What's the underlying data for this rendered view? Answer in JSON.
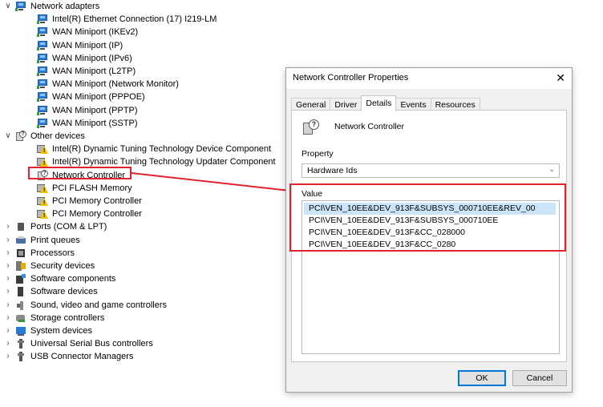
{
  "tree": {
    "items": [
      {
        "label": "Network adapters",
        "icon": "network-adapter-icon",
        "kind": "net",
        "expand": "open"
      },
      {
        "label": "Intel(R) Ethernet Connection (17) I219-LM",
        "icon": "network-adapter-icon",
        "kind": "net"
      },
      {
        "label": "WAN Miniport (IKEv2)",
        "icon": "network-adapter-icon",
        "kind": "net"
      },
      {
        "label": "WAN Miniport (IP)",
        "icon": "network-adapter-icon",
        "kind": "net"
      },
      {
        "label": "WAN Miniport (IPv6)",
        "icon": "network-adapter-icon",
        "kind": "net"
      },
      {
        "label": "WAN Miniport (L2TP)",
        "icon": "network-adapter-icon",
        "kind": "net"
      },
      {
        "label": "WAN Miniport (Network Monitor)",
        "icon": "network-adapter-icon",
        "kind": "net"
      },
      {
        "label": "WAN Miniport (PPPOE)",
        "icon": "network-adapter-icon",
        "kind": "net"
      },
      {
        "label": "WAN Miniport (PPTP)",
        "icon": "network-adapter-icon",
        "kind": "net"
      },
      {
        "label": "WAN Miniport (SSTP)",
        "icon": "network-adapter-icon",
        "kind": "net"
      },
      {
        "label": "Other devices",
        "icon": "unknown-device-icon",
        "kind": "unk",
        "expand": "open"
      },
      {
        "label": "Intel(R) Dynamic Tuning Technology Device Component",
        "icon": "warning-device-icon",
        "kind": "warn"
      },
      {
        "label": "Intel(R) Dynamic Tuning Technology Updater Component",
        "icon": "warning-device-icon",
        "kind": "warn"
      },
      {
        "label": "Network Controller",
        "icon": "unknown-device-icon",
        "kind": "unk"
      },
      {
        "label": "PCI FLASH Memory",
        "icon": "warning-device-icon",
        "kind": "warn"
      },
      {
        "label": "PCI Memory Controller",
        "icon": "warning-device-icon",
        "kind": "warn"
      },
      {
        "label": "PCI Memory Controller",
        "icon": "warning-device-icon",
        "kind": "warn"
      },
      {
        "label": "Ports (COM & LPT)",
        "icon": "port-icon",
        "kind": "port",
        "expand": "closed"
      },
      {
        "label": "Print queues",
        "icon": "printer-icon",
        "kind": "print",
        "expand": "closed"
      },
      {
        "label": "Processors",
        "icon": "processor-icon",
        "kind": "proc",
        "expand": "closed"
      },
      {
        "label": "Security devices",
        "icon": "security-device-icon",
        "kind": "sec",
        "expand": "closed"
      },
      {
        "label": "Software components",
        "icon": "software-component-icon",
        "kind": "comp",
        "expand": "closed"
      },
      {
        "label": "Software devices",
        "icon": "software-device-icon",
        "kind": "sw",
        "expand": "closed"
      },
      {
        "label": "Sound, video and game controllers",
        "icon": "speaker-icon",
        "kind": "snd",
        "expand": "closed"
      },
      {
        "label": "Storage controllers",
        "icon": "storage-controller-icon",
        "kind": "stor",
        "expand": "closed"
      },
      {
        "label": "System devices",
        "icon": "system-device-icon",
        "kind": "sys",
        "expand": "closed"
      },
      {
        "label": "Universal Serial Bus controllers",
        "icon": "usb-icon",
        "kind": "usb",
        "expand": "closed"
      },
      {
        "label": "USB Connector Managers",
        "icon": "usb-icon",
        "kind": "usb",
        "expand": "closed"
      }
    ]
  },
  "dialog": {
    "title": "Network Controller Properties",
    "close_glyph": "✕",
    "tabs": [
      "General",
      "Driver",
      "Details",
      "Events",
      "Resources"
    ],
    "active_tab": "Details",
    "device_name": "Network Controller",
    "property_label": "Property",
    "property_value": "Hardware Ids",
    "value_label": "Value",
    "values": [
      "PCI\\VEN_10EE&DEV_913F&SUBSYS_000710EE&REV_00",
      "PCI\\VEN_10EE&DEV_913F&SUBSYS_000710EE",
      "PCI\\VEN_10EE&DEV_913F&CC_028000",
      "PCI\\VEN_10EE&DEV_913F&CC_0280"
    ],
    "ok_label": "OK",
    "cancel_label": "Cancel"
  },
  "colors": {
    "annotation_red": "#e0232d",
    "selection": "#cce4f7",
    "accent": "#0078d7"
  }
}
